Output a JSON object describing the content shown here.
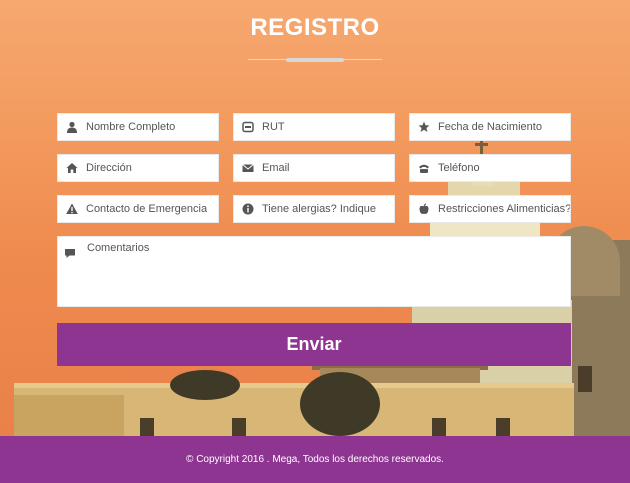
{
  "page": {
    "title": "REGISTRO",
    "accent_color": "#8e3491"
  },
  "form": {
    "fields": [
      {
        "icon": "user-icon",
        "placeholder": "Nombre Completo"
      },
      {
        "icon": "id-card-icon",
        "placeholder": "RUT"
      },
      {
        "icon": "star-icon",
        "placeholder": "Fecha de Nacimiento"
      },
      {
        "icon": "home-icon",
        "placeholder": "Dirección"
      },
      {
        "icon": "envelope-icon",
        "placeholder": "Email"
      },
      {
        "icon": "phone-icon",
        "placeholder": "Teléfono"
      },
      {
        "icon": "warning-icon",
        "placeholder": "Contacto de Emergencia"
      },
      {
        "icon": "info-icon",
        "placeholder": "Tiene alergias? Indique"
      },
      {
        "icon": "apple-icon",
        "placeholder": "Restricciones Alimenticias? In"
      }
    ],
    "comments": {
      "icon": "comment-icon",
      "placeholder": "Comentarios"
    },
    "submit_label": "Enviar"
  },
  "footer": {
    "copyright": "© Copyright 2016 . Mega, Todos los derechos reservados."
  }
}
